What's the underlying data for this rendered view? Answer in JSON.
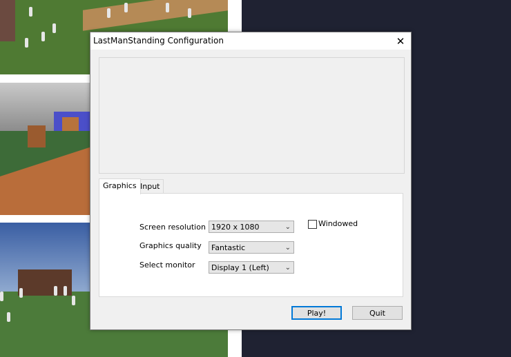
{
  "window": {
    "title": "LastManStanding Configuration",
    "close_glyph": "✕"
  },
  "tabs": [
    {
      "label": "Graphics",
      "active": true
    },
    {
      "label": "Input",
      "active": false
    }
  ],
  "graphics": {
    "screen_resolution_label": "Screen resolution",
    "screen_resolution_value": "1920 x 1080",
    "graphics_quality_label": "Graphics quality",
    "graphics_quality_value": "Fantastic",
    "select_monitor_label": "Select monitor",
    "select_monitor_value": "Display 1 (Left)",
    "windowed_label": "Windowed",
    "windowed_checked": false
  },
  "buttons": {
    "play_label": "Play!",
    "quit_label": "Quit"
  },
  "icons": {
    "dropdown": "chevron-down-icon",
    "close": "close-icon"
  },
  "colors": {
    "focus_border": "#0078d7",
    "desktop": "#1f2232"
  }
}
